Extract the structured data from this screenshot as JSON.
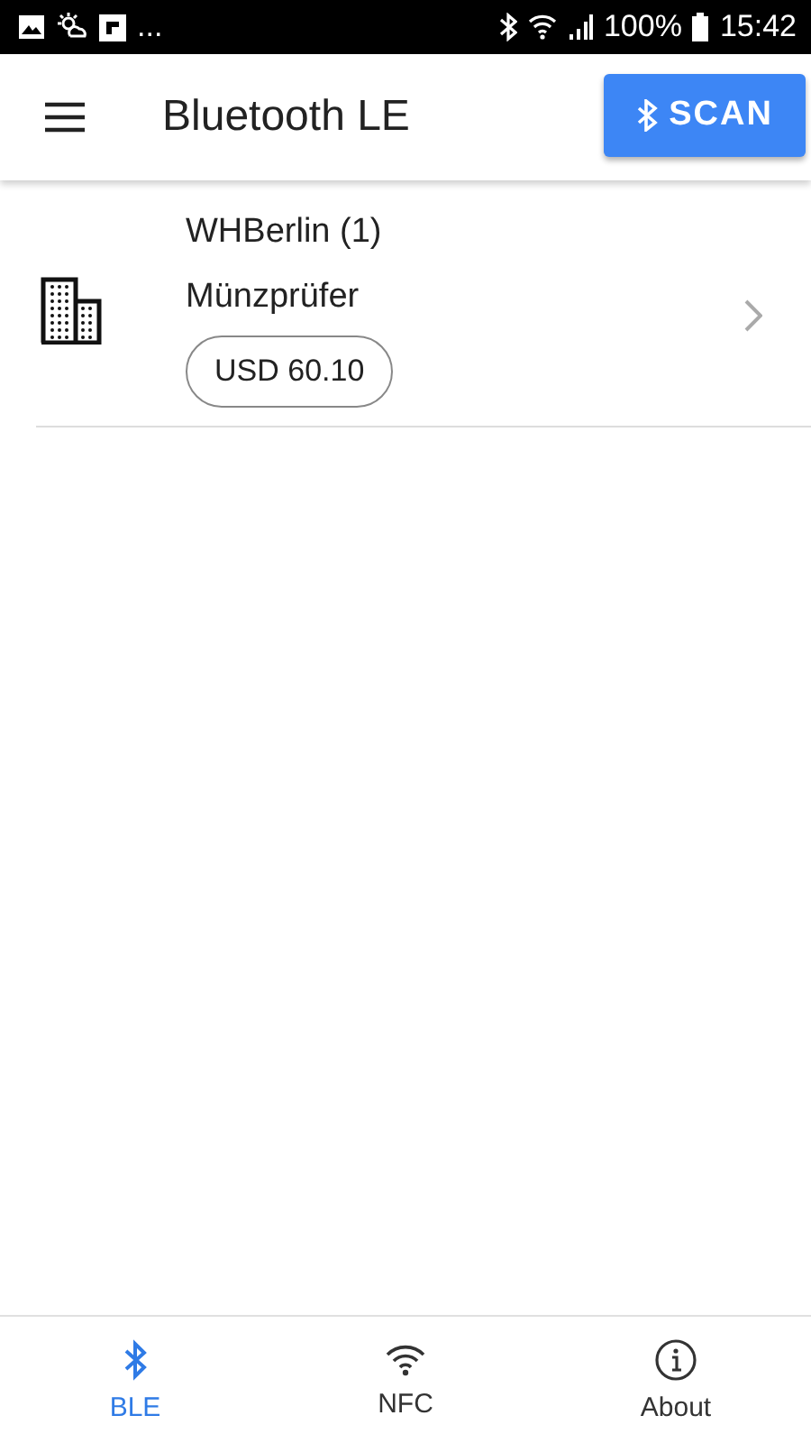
{
  "status_bar": {
    "notifications_more": "...",
    "battery": "100%",
    "time": "15:42"
  },
  "app_bar": {
    "title": "Bluetooth LE",
    "action": "SCAN"
  },
  "devices": [
    {
      "name": "WHBerlin (1)",
      "type": "Münzprüfer",
      "amount": "USD 60.10"
    }
  ],
  "bottom_nav": [
    {
      "kind": "ble",
      "label": "BLE",
      "selected": true
    },
    {
      "kind": "nfc",
      "label": "NFC",
      "selected": false
    },
    {
      "kind": "about",
      "label": "About",
      "selected": false
    }
  ]
}
